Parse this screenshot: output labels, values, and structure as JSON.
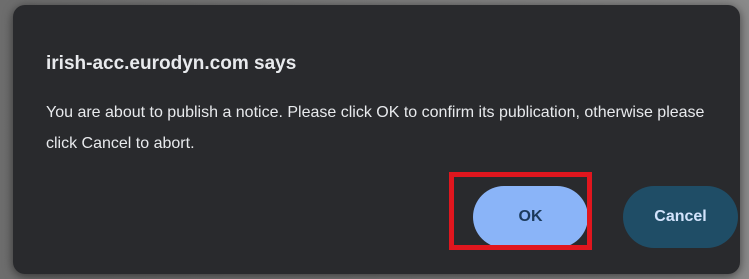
{
  "dialog": {
    "title": "irish-acc.eurodyn.com says",
    "message": "You are about to publish a notice. Please click OK to confirm its publication, otherwise please click Cancel to abort.",
    "ok_label": "OK",
    "cancel_label": "Cancel"
  },
  "colors": {
    "dialog_background": "#292a2d",
    "text": "#e8eaed",
    "ok_button": "#8ab4f8",
    "cancel_button": "#1f4d66",
    "highlight": "#e0161e"
  }
}
